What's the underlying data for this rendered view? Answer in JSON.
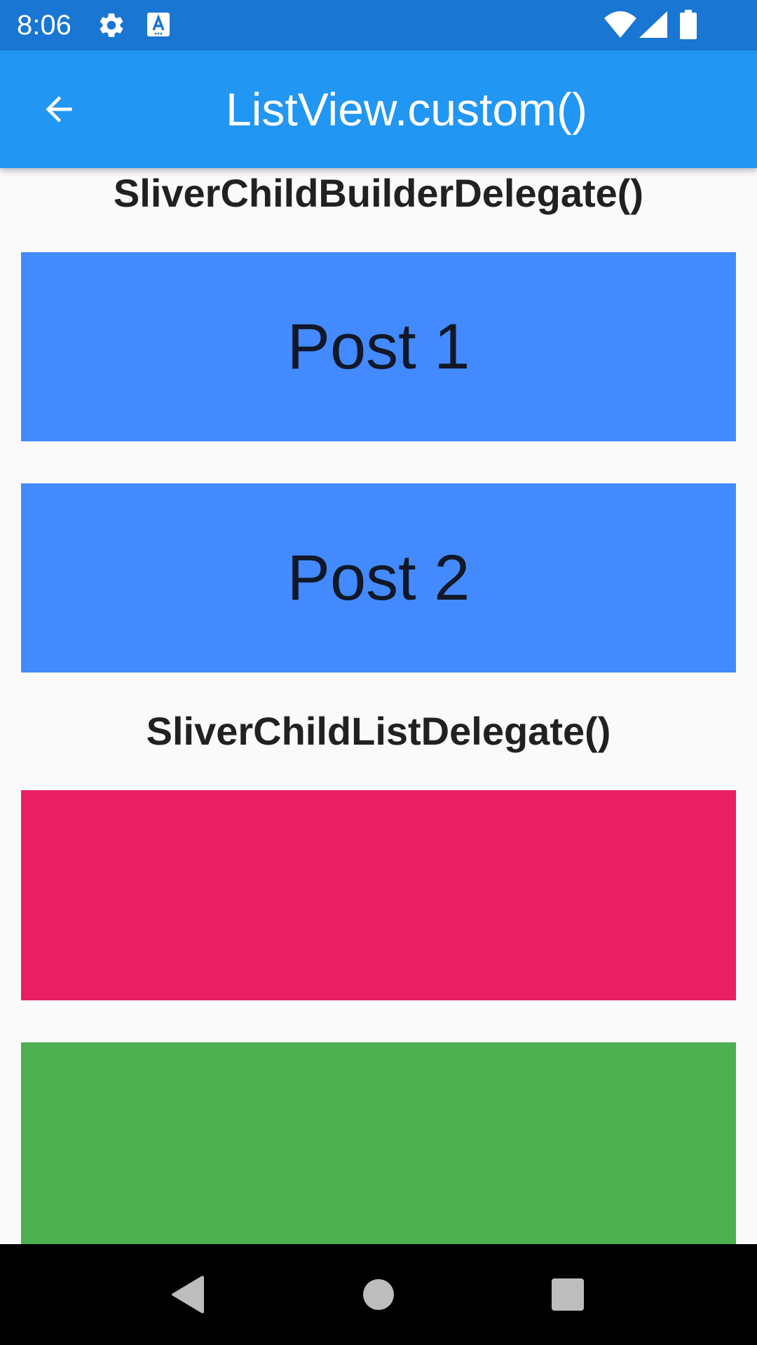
{
  "status_bar": {
    "time": "8:06",
    "background": "#1976d2",
    "icons": [
      "settings-icon",
      "keyboard-a-icon",
      "wifi-icon",
      "signal-icon",
      "battery-icon"
    ]
  },
  "app_bar": {
    "title": "ListView.custom()",
    "background": "#2196f3",
    "back_icon": "arrow-back-icon"
  },
  "sections": [
    {
      "heading": "SliverChildBuilderDelegate()",
      "posts": [
        {
          "label": "Post 1",
          "color": "#448aff"
        },
        {
          "label": "Post 2",
          "color": "#448aff"
        }
      ]
    },
    {
      "heading": "SliverChildListDelegate()",
      "blocks": [
        {
          "color": "#e91e63"
        },
        {
          "color": "#4caf50"
        }
      ]
    }
  ],
  "nav_bar": {
    "buttons": [
      "back-triangle-icon",
      "home-circle-icon",
      "recents-square-icon"
    ]
  }
}
